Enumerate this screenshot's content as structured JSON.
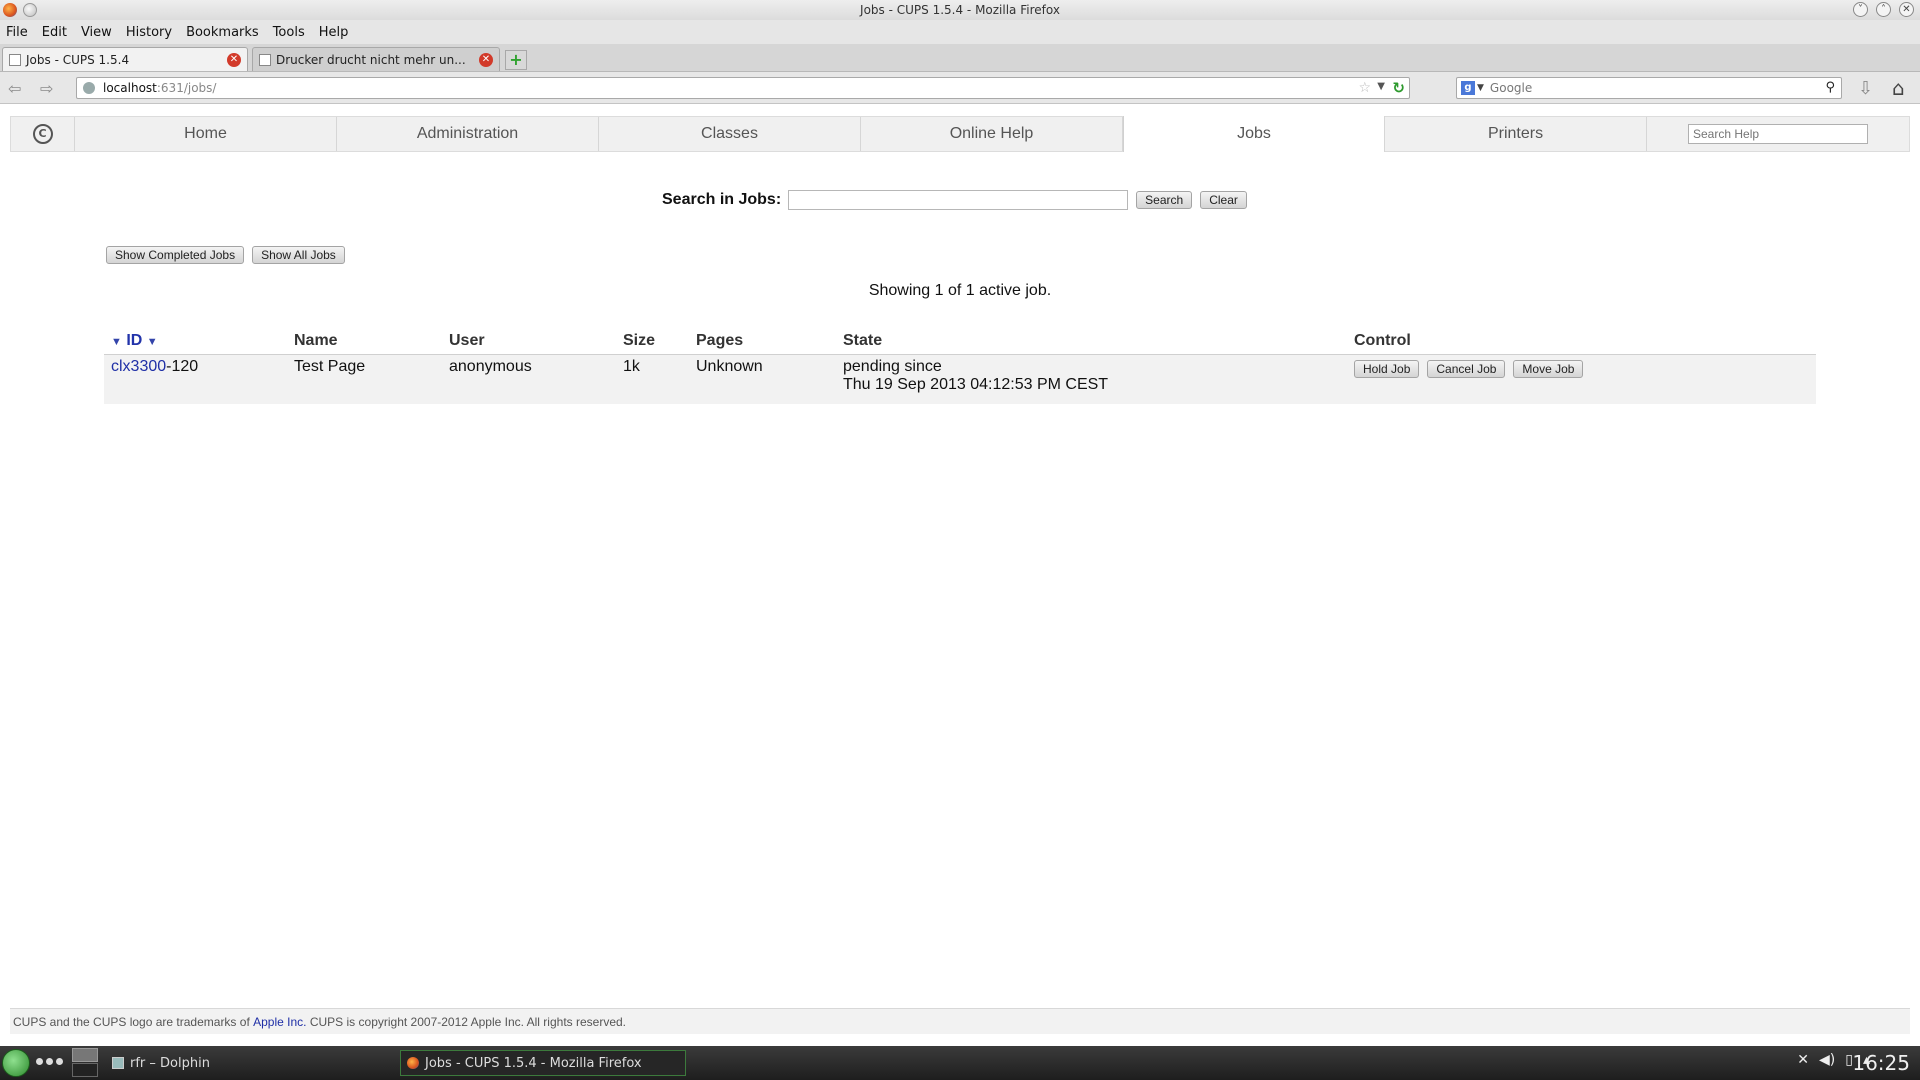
{
  "window": {
    "title": "Jobs - CUPS 1.5.4 - Mozilla Firefox"
  },
  "menu": [
    "File",
    "Edit",
    "View",
    "History",
    "Bookmarks",
    "Tools",
    "Help"
  ],
  "tabs": [
    {
      "label": "Jobs - CUPS 1.5.4"
    },
    {
      "label": "Drucker drucht nicht mehr un..."
    }
  ],
  "navbar": {
    "url_host": "localhost",
    "url_path": ":631/jobs/",
    "search_placeholder": "Google"
  },
  "cups_nav": {
    "items": [
      "Home",
      "Administration",
      "Classes",
      "Online Help",
      "Jobs",
      "Printers"
    ],
    "selected": "Jobs",
    "search_placeholder": "Search Help"
  },
  "search": {
    "label": "Search in Jobs:",
    "search_button": "Search",
    "clear_button": "Clear"
  },
  "filters": {
    "show_completed": "Show Completed Jobs",
    "show_all": "Show All Jobs"
  },
  "summary": "Showing 1 of 1 active job.",
  "table": {
    "sort_up": "▼",
    "sort_down": "▼",
    "columns": [
      "ID",
      "Name",
      "User",
      "Size",
      "Pages",
      "State",
      "Control"
    ],
    "rows": [
      {
        "printer": "clx3300",
        "job_suffix": "-120",
        "name": "Test Page",
        "user": "anonymous",
        "size": "1k",
        "pages": "Unknown",
        "state_line1": "pending since",
        "state_line2": "Thu 19 Sep 2013 04:12:53 PM CEST",
        "controls": [
          "Hold Job",
          "Cancel Job",
          "Move Job"
        ]
      }
    ]
  },
  "footer": {
    "text_before": "CUPS and the CUPS logo are trademarks of ",
    "link": "Apple Inc.",
    "text_after": " CUPS is copyright 2007-2012 Apple Inc. All rights reserved."
  },
  "taskbar": {
    "tasks": [
      "rfr – Dolphin",
      "Jobs - CUPS 1.5.4 - Mozilla Firefox"
    ],
    "clock": "16:25"
  }
}
